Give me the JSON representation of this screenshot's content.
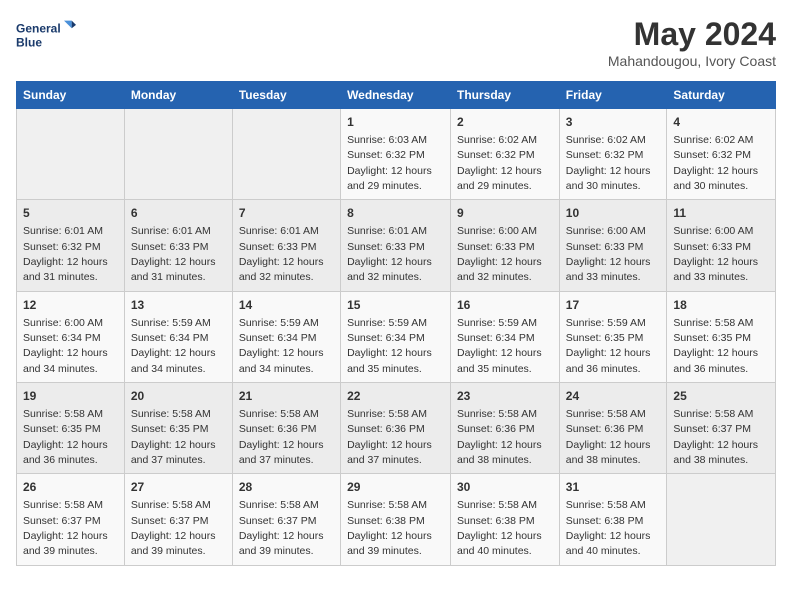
{
  "header": {
    "logo_line1": "General",
    "logo_line2": "Blue",
    "title": "May 2024",
    "subtitle": "Mahandougou, Ivory Coast"
  },
  "days_of_week": [
    "Sunday",
    "Monday",
    "Tuesday",
    "Wednesday",
    "Thursday",
    "Friday",
    "Saturday"
  ],
  "weeks": [
    [
      {
        "day": "",
        "info": ""
      },
      {
        "day": "",
        "info": ""
      },
      {
        "day": "",
        "info": ""
      },
      {
        "day": "1",
        "info": "Sunrise: 6:03 AM\nSunset: 6:32 PM\nDaylight: 12 hours and 29 minutes."
      },
      {
        "day": "2",
        "info": "Sunrise: 6:02 AM\nSunset: 6:32 PM\nDaylight: 12 hours and 29 minutes."
      },
      {
        "day": "3",
        "info": "Sunrise: 6:02 AM\nSunset: 6:32 PM\nDaylight: 12 hours and 30 minutes."
      },
      {
        "day": "4",
        "info": "Sunrise: 6:02 AM\nSunset: 6:32 PM\nDaylight: 12 hours and 30 minutes."
      }
    ],
    [
      {
        "day": "5",
        "info": "Sunrise: 6:01 AM\nSunset: 6:32 PM\nDaylight: 12 hours and 31 minutes."
      },
      {
        "day": "6",
        "info": "Sunrise: 6:01 AM\nSunset: 6:33 PM\nDaylight: 12 hours and 31 minutes."
      },
      {
        "day": "7",
        "info": "Sunrise: 6:01 AM\nSunset: 6:33 PM\nDaylight: 12 hours and 32 minutes."
      },
      {
        "day": "8",
        "info": "Sunrise: 6:01 AM\nSunset: 6:33 PM\nDaylight: 12 hours and 32 minutes."
      },
      {
        "day": "9",
        "info": "Sunrise: 6:00 AM\nSunset: 6:33 PM\nDaylight: 12 hours and 32 minutes."
      },
      {
        "day": "10",
        "info": "Sunrise: 6:00 AM\nSunset: 6:33 PM\nDaylight: 12 hours and 33 minutes."
      },
      {
        "day": "11",
        "info": "Sunrise: 6:00 AM\nSunset: 6:33 PM\nDaylight: 12 hours and 33 minutes."
      }
    ],
    [
      {
        "day": "12",
        "info": "Sunrise: 6:00 AM\nSunset: 6:34 PM\nDaylight: 12 hours and 34 minutes."
      },
      {
        "day": "13",
        "info": "Sunrise: 5:59 AM\nSunset: 6:34 PM\nDaylight: 12 hours and 34 minutes."
      },
      {
        "day": "14",
        "info": "Sunrise: 5:59 AM\nSunset: 6:34 PM\nDaylight: 12 hours and 34 minutes."
      },
      {
        "day": "15",
        "info": "Sunrise: 5:59 AM\nSunset: 6:34 PM\nDaylight: 12 hours and 35 minutes."
      },
      {
        "day": "16",
        "info": "Sunrise: 5:59 AM\nSunset: 6:34 PM\nDaylight: 12 hours and 35 minutes."
      },
      {
        "day": "17",
        "info": "Sunrise: 5:59 AM\nSunset: 6:35 PM\nDaylight: 12 hours and 36 minutes."
      },
      {
        "day": "18",
        "info": "Sunrise: 5:58 AM\nSunset: 6:35 PM\nDaylight: 12 hours and 36 minutes."
      }
    ],
    [
      {
        "day": "19",
        "info": "Sunrise: 5:58 AM\nSunset: 6:35 PM\nDaylight: 12 hours and 36 minutes."
      },
      {
        "day": "20",
        "info": "Sunrise: 5:58 AM\nSunset: 6:35 PM\nDaylight: 12 hours and 37 minutes."
      },
      {
        "day": "21",
        "info": "Sunrise: 5:58 AM\nSunset: 6:36 PM\nDaylight: 12 hours and 37 minutes."
      },
      {
        "day": "22",
        "info": "Sunrise: 5:58 AM\nSunset: 6:36 PM\nDaylight: 12 hours and 37 minutes."
      },
      {
        "day": "23",
        "info": "Sunrise: 5:58 AM\nSunset: 6:36 PM\nDaylight: 12 hours and 38 minutes."
      },
      {
        "day": "24",
        "info": "Sunrise: 5:58 AM\nSunset: 6:36 PM\nDaylight: 12 hours and 38 minutes."
      },
      {
        "day": "25",
        "info": "Sunrise: 5:58 AM\nSunset: 6:37 PM\nDaylight: 12 hours and 38 minutes."
      }
    ],
    [
      {
        "day": "26",
        "info": "Sunrise: 5:58 AM\nSunset: 6:37 PM\nDaylight: 12 hours and 39 minutes."
      },
      {
        "day": "27",
        "info": "Sunrise: 5:58 AM\nSunset: 6:37 PM\nDaylight: 12 hours and 39 minutes."
      },
      {
        "day": "28",
        "info": "Sunrise: 5:58 AM\nSunset: 6:37 PM\nDaylight: 12 hours and 39 minutes."
      },
      {
        "day": "29",
        "info": "Sunrise: 5:58 AM\nSunset: 6:38 PM\nDaylight: 12 hours and 39 minutes."
      },
      {
        "day": "30",
        "info": "Sunrise: 5:58 AM\nSunset: 6:38 PM\nDaylight: 12 hours and 40 minutes."
      },
      {
        "day": "31",
        "info": "Sunrise: 5:58 AM\nSunset: 6:38 PM\nDaylight: 12 hours and 40 minutes."
      },
      {
        "day": "",
        "info": ""
      }
    ]
  ]
}
